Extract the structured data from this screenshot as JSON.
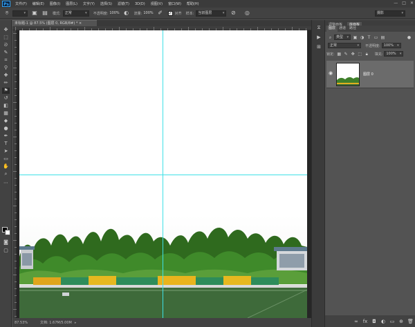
{
  "app": {
    "logo": "Ps",
    "menu": [
      "文件(F)",
      "编辑(E)",
      "图像(I)",
      "图层(L)",
      "文字(Y)",
      "选择(S)",
      "滤镜(T)",
      "3D(D)",
      "视图(V)",
      "窗口(W)",
      "帮助(H)"
    ],
    "window_controls": [
      "—",
      "□",
      "✕"
    ]
  },
  "options_bar": {
    "mode_label": "模式:",
    "mode_value": "正常",
    "opacity_label": "不透明度:",
    "opacity_value": "100%",
    "flow_label": "流量:",
    "flow_value": "100%",
    "align_label": "对齐",
    "sample_label": "样本:",
    "sample_value": "当前图层",
    "workspace_value": "摄影"
  },
  "document": {
    "tab_title": "未标题-1 @ 87.5% (图层 0, RGB/8#) * ×",
    "zoom": "87.53%",
    "doc_info": "文档: 1.67M/5.00M"
  },
  "panels": {
    "top_tabs": [
      "调整面板",
      "库面板"
    ],
    "layer_tabs": [
      "图层",
      "通道",
      "路径"
    ],
    "kind_filter": "类型",
    "blend_mode": "正常",
    "opacity_label": "不透明度:",
    "opacity_value": "100%",
    "lock_label": "锁定:",
    "fill_label": "填充:",
    "fill_value": "100%",
    "layer_name": "图层 0",
    "footer_icons": [
      "link-icon",
      "fx-icon",
      "mask-icon",
      "adjustment-icon",
      "group-icon",
      "new-layer-icon",
      "trash-icon"
    ]
  },
  "colors": {
    "guide": "#3fe0e6",
    "canvas": "#ffffff",
    "chrome": "#535353"
  }
}
